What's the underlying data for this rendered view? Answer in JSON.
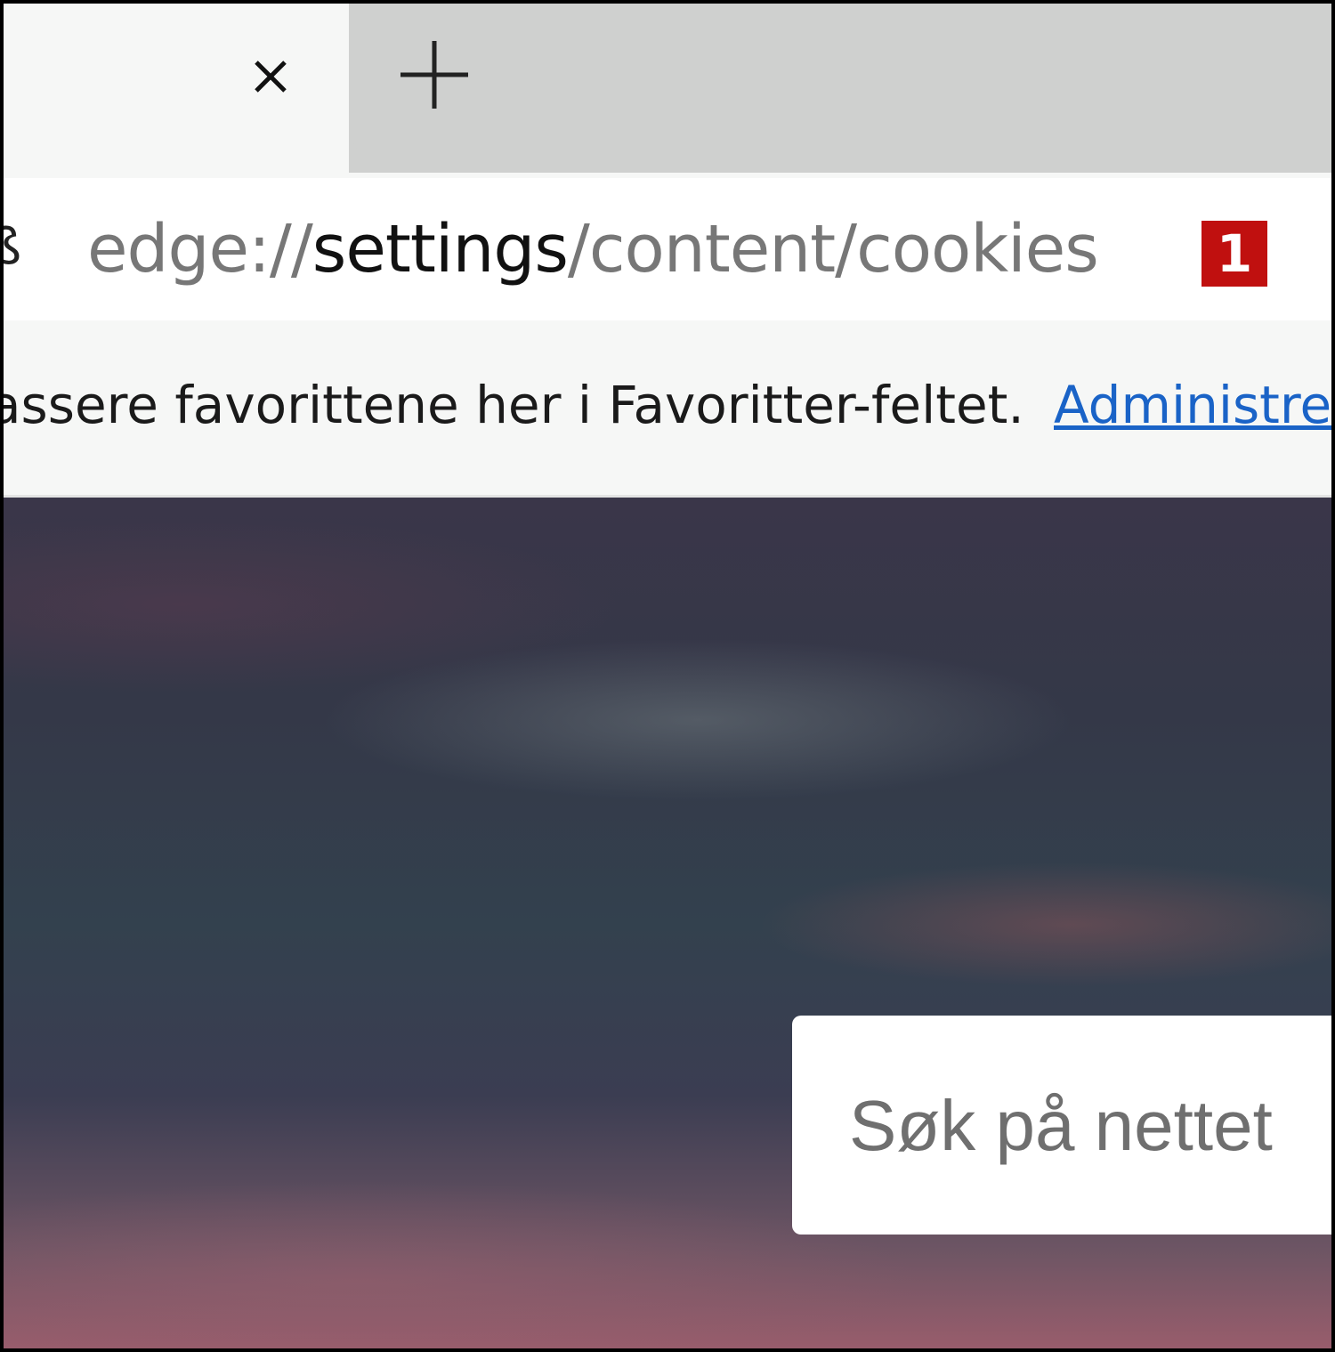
{
  "tabs": {
    "close_icon": "close-icon",
    "new_tab_icon": "plus-icon"
  },
  "address_bar": {
    "site_icon_glyph": "ß",
    "url_prefix": "edge://",
    "url_host": "settings",
    "url_path": "/content/cookies",
    "callout_number": "1",
    "callout_color": "#c0100f"
  },
  "favorites_bar": {
    "message": "assere favorittene her i Favoritter-feltet.",
    "manage_link": "Administre"
  },
  "new_tab_page": {
    "search_placeholder": "Søk på nettet"
  }
}
